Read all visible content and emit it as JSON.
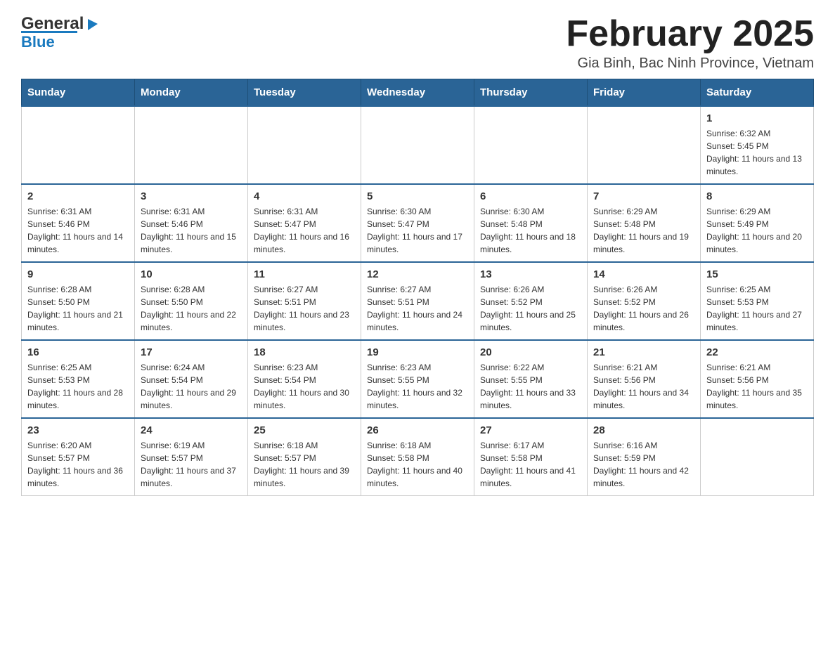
{
  "header": {
    "logo_general": "General",
    "logo_blue": "Blue",
    "title": "February 2025",
    "subtitle": "Gia Binh, Bac Ninh Province, Vietnam"
  },
  "days_of_week": [
    "Sunday",
    "Monday",
    "Tuesday",
    "Wednesday",
    "Thursday",
    "Friday",
    "Saturday"
  ],
  "weeks": [
    {
      "days": [
        {
          "number": "",
          "info": ""
        },
        {
          "number": "",
          "info": ""
        },
        {
          "number": "",
          "info": ""
        },
        {
          "number": "",
          "info": ""
        },
        {
          "number": "",
          "info": ""
        },
        {
          "number": "",
          "info": ""
        },
        {
          "number": "1",
          "info": "Sunrise: 6:32 AM\nSunset: 5:45 PM\nDaylight: 11 hours and 13 minutes."
        }
      ]
    },
    {
      "days": [
        {
          "number": "2",
          "info": "Sunrise: 6:31 AM\nSunset: 5:46 PM\nDaylight: 11 hours and 14 minutes."
        },
        {
          "number": "3",
          "info": "Sunrise: 6:31 AM\nSunset: 5:46 PM\nDaylight: 11 hours and 15 minutes."
        },
        {
          "number": "4",
          "info": "Sunrise: 6:31 AM\nSunset: 5:47 PM\nDaylight: 11 hours and 16 minutes."
        },
        {
          "number": "5",
          "info": "Sunrise: 6:30 AM\nSunset: 5:47 PM\nDaylight: 11 hours and 17 minutes."
        },
        {
          "number": "6",
          "info": "Sunrise: 6:30 AM\nSunset: 5:48 PM\nDaylight: 11 hours and 18 minutes."
        },
        {
          "number": "7",
          "info": "Sunrise: 6:29 AM\nSunset: 5:48 PM\nDaylight: 11 hours and 19 minutes."
        },
        {
          "number": "8",
          "info": "Sunrise: 6:29 AM\nSunset: 5:49 PM\nDaylight: 11 hours and 20 minutes."
        }
      ]
    },
    {
      "days": [
        {
          "number": "9",
          "info": "Sunrise: 6:28 AM\nSunset: 5:50 PM\nDaylight: 11 hours and 21 minutes."
        },
        {
          "number": "10",
          "info": "Sunrise: 6:28 AM\nSunset: 5:50 PM\nDaylight: 11 hours and 22 minutes."
        },
        {
          "number": "11",
          "info": "Sunrise: 6:27 AM\nSunset: 5:51 PM\nDaylight: 11 hours and 23 minutes."
        },
        {
          "number": "12",
          "info": "Sunrise: 6:27 AM\nSunset: 5:51 PM\nDaylight: 11 hours and 24 minutes."
        },
        {
          "number": "13",
          "info": "Sunrise: 6:26 AM\nSunset: 5:52 PM\nDaylight: 11 hours and 25 minutes."
        },
        {
          "number": "14",
          "info": "Sunrise: 6:26 AM\nSunset: 5:52 PM\nDaylight: 11 hours and 26 minutes."
        },
        {
          "number": "15",
          "info": "Sunrise: 6:25 AM\nSunset: 5:53 PM\nDaylight: 11 hours and 27 minutes."
        }
      ]
    },
    {
      "days": [
        {
          "number": "16",
          "info": "Sunrise: 6:25 AM\nSunset: 5:53 PM\nDaylight: 11 hours and 28 minutes."
        },
        {
          "number": "17",
          "info": "Sunrise: 6:24 AM\nSunset: 5:54 PM\nDaylight: 11 hours and 29 minutes."
        },
        {
          "number": "18",
          "info": "Sunrise: 6:23 AM\nSunset: 5:54 PM\nDaylight: 11 hours and 30 minutes."
        },
        {
          "number": "19",
          "info": "Sunrise: 6:23 AM\nSunset: 5:55 PM\nDaylight: 11 hours and 32 minutes."
        },
        {
          "number": "20",
          "info": "Sunrise: 6:22 AM\nSunset: 5:55 PM\nDaylight: 11 hours and 33 minutes."
        },
        {
          "number": "21",
          "info": "Sunrise: 6:21 AM\nSunset: 5:56 PM\nDaylight: 11 hours and 34 minutes."
        },
        {
          "number": "22",
          "info": "Sunrise: 6:21 AM\nSunset: 5:56 PM\nDaylight: 11 hours and 35 minutes."
        }
      ]
    },
    {
      "days": [
        {
          "number": "23",
          "info": "Sunrise: 6:20 AM\nSunset: 5:57 PM\nDaylight: 11 hours and 36 minutes."
        },
        {
          "number": "24",
          "info": "Sunrise: 6:19 AM\nSunset: 5:57 PM\nDaylight: 11 hours and 37 minutes."
        },
        {
          "number": "25",
          "info": "Sunrise: 6:18 AM\nSunset: 5:57 PM\nDaylight: 11 hours and 39 minutes."
        },
        {
          "number": "26",
          "info": "Sunrise: 6:18 AM\nSunset: 5:58 PM\nDaylight: 11 hours and 40 minutes."
        },
        {
          "number": "27",
          "info": "Sunrise: 6:17 AM\nSunset: 5:58 PM\nDaylight: 11 hours and 41 minutes."
        },
        {
          "number": "28",
          "info": "Sunrise: 6:16 AM\nSunset: 5:59 PM\nDaylight: 11 hours and 42 minutes."
        },
        {
          "number": "",
          "info": ""
        }
      ]
    }
  ]
}
